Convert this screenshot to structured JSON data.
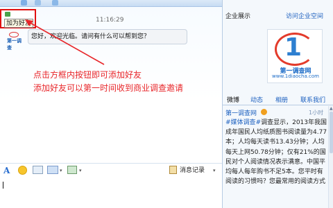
{
  "chat": {
    "add_friend_tooltip": "加为好友",
    "message_time": "11:16:29",
    "avatar_text": "第一调查",
    "message_text": "您好，欢迎光临。请问有什么可以帮到您？"
  },
  "annotation": {
    "line1": "点击方框内按钮即可添加好友",
    "line2": "添加好友可以第一时间收到商业调查邀请",
    "color": "#e8262a"
  },
  "input_toolbar": {
    "font_icon": "A",
    "history_label": "消息记录",
    "caret": "▾"
  },
  "company_panel": {
    "title": "企业展示",
    "visit_link": "访问企业空间",
    "logo_mark": "1",
    "logo_name": "第一调查网",
    "logo_url": "www.1diaocha.com"
  },
  "tabs": [
    "微博",
    "动态",
    "相册",
    "联系我们"
  ],
  "feed": {
    "user": "第一调查网",
    "time": "1小时",
    "tag": "#媒体调查#",
    "text": "调查显示，2013年我国成年国民人均纸质图书阅读量为4.77本；人均每天读书13.43分钟；人均每天上网50.78分钟；仅有21%的国民对个人阅读情况表示满意。中国平均每人每年购书不足5本。您平时有阅读的习惯吗？您最常用的阅读方式"
  },
  "colors": {
    "accent_blue": "#1b5fbf",
    "highlight_red": "#e01010"
  }
}
